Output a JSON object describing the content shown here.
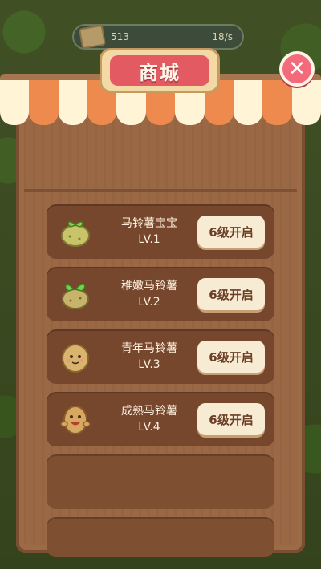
{
  "resource_bar": {
    "amount": "513",
    "rate": "18/s"
  },
  "shop": {
    "title": "商城"
  },
  "colors": {
    "awning_stripes": [
      "#fff4d6",
      "#ef8a4e",
      "#fff4d6",
      "#ef8a4e",
      "#fff4d6",
      "#ef8a4e",
      "#fff4d6",
      "#ef8a4e",
      "#fff4d6",
      "#ef8a4e",
      "#fff4d6"
    ]
  },
  "items": [
    {
      "name": "马铃薯宝宝",
      "level": "LV.1",
      "button": "6级开启",
      "icon": "potato-baby-icon"
    },
    {
      "name": "稚嫩马铃薯",
      "level": "LV.2",
      "button": "6级开启",
      "icon": "potato-sprout-icon"
    },
    {
      "name": "青年马铃薯",
      "level": "LV.3",
      "button": "6级开启",
      "icon": "potato-youth-icon"
    },
    {
      "name": "成熟马铃薯",
      "level": "LV.4",
      "button": "6级开启",
      "icon": "potato-mature-icon"
    }
  ]
}
